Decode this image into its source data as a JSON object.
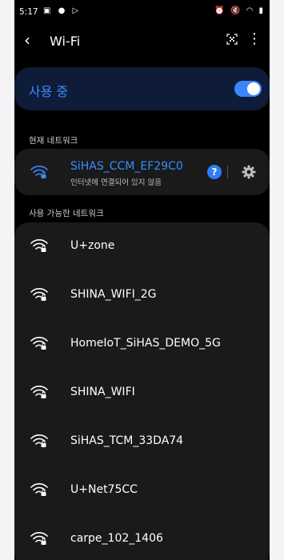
{
  "status_bar": {
    "time": "5:17",
    "left_icons": "▣ ● ▷",
    "right_icons": "⏰ 🔇 ◠ ▮"
  },
  "header": {
    "back_icon": "‹",
    "title": "Wi-Fi",
    "more_icon": "⋮"
  },
  "toggle": {
    "label": "사용 중",
    "state": "on"
  },
  "current_network": {
    "section_label": "현재 네트워크",
    "name": "SiHAS_CCM_EF29C0",
    "status": "인터넷에 연결되어 있지 않음",
    "help_label": "?"
  },
  "available_networks": {
    "section_label": "사용 가능한 네트워크",
    "items": [
      {
        "name": "U+zone"
      },
      {
        "name": "SHINA_WIFI_2G"
      },
      {
        "name": "HomeIoT_SiHAS_DEMO_5G"
      },
      {
        "name": "SHINA_WIFI"
      },
      {
        "name": "SiHAS_TCM_33DA74"
      },
      {
        "name": "U+Net75CC"
      },
      {
        "name": "carpe_102_1406"
      }
    ]
  },
  "colors": {
    "accent": "#3a8dff",
    "card": "#1a1a1a",
    "toggle_card": "#0e1c3a"
  }
}
